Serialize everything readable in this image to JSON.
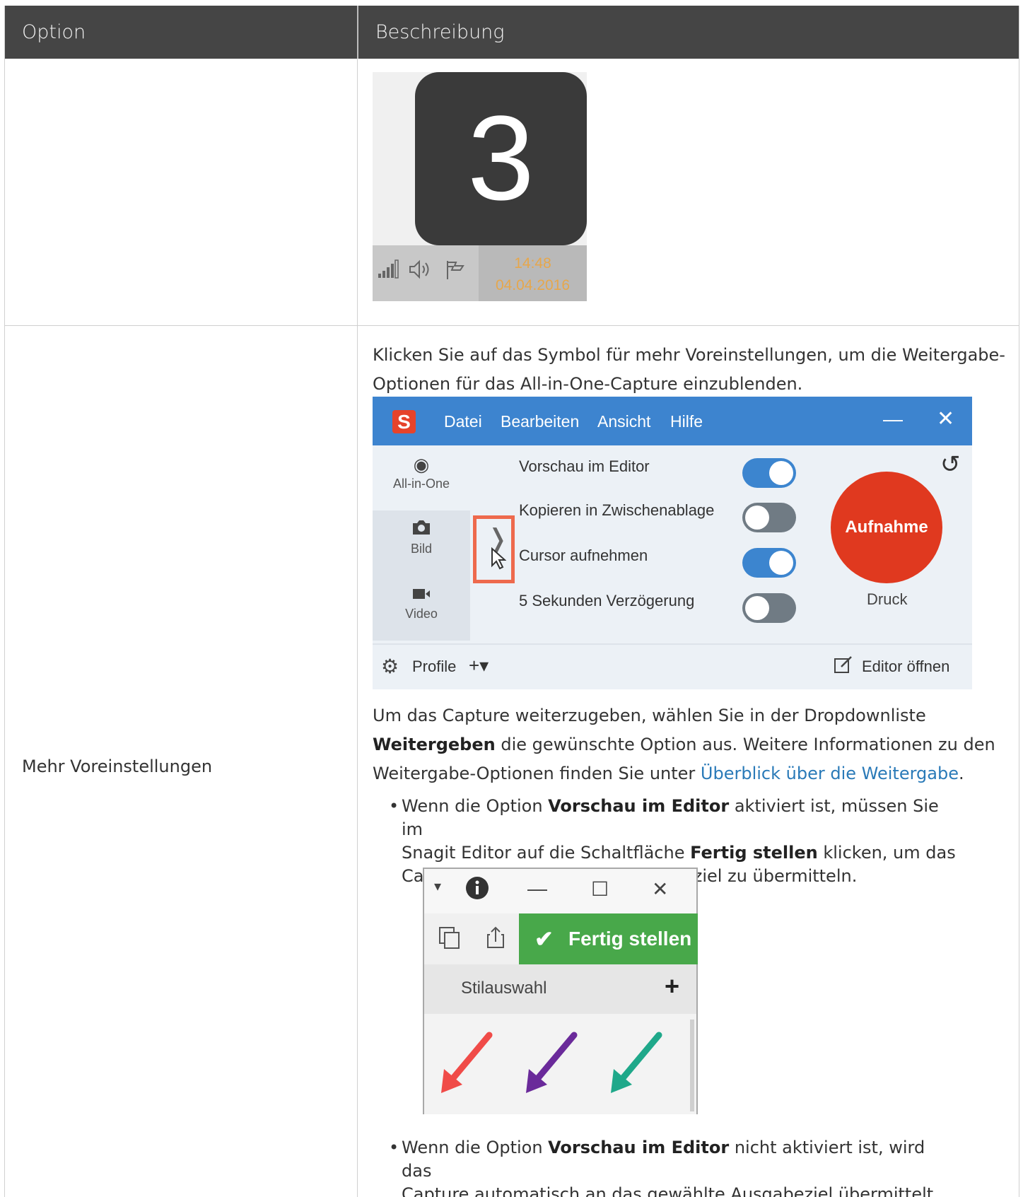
{
  "table": {
    "header": {
      "option": "Option",
      "description": "Beschreibung"
    },
    "row2_option": "Mehr Voreinstellungen"
  },
  "countdown": {
    "number": "3",
    "time": "14:48",
    "date": "04.04.2016"
  },
  "intro_text": {
    "line1": "Klicken Sie auf das Symbol für mehr Voreinstellungen, um die Weitergabe-",
    "line2": "Optionen für das All-in-One-Capture einzublenden."
  },
  "capture_window": {
    "logo": "S",
    "menu": [
      "Datei",
      "Bearbeiten",
      "Ansicht",
      "Hilfe"
    ],
    "modes": [
      "All-in-One",
      "Bild",
      "Video"
    ],
    "options": [
      {
        "label": "Vorschau im Editor",
        "on": true
      },
      {
        "label": "Kopieren in Zwischenablage",
        "on": false
      },
      {
        "label": "Cursor aufnehmen",
        "on": true
      },
      {
        "label": "5 Sekunden Verzögerung",
        "on": false
      }
    ],
    "capture_button": "Aufnahme",
    "hotkey": "Druck",
    "profiles": "Profile",
    "open_editor": "Editor öffnen"
  },
  "share_text": {
    "line1": "Um das Capture weiterzugeben, wählen Sie in der Dropdownliste",
    "line2_bold": "Weitergeben",
    "line2_rest": " die gewünschte Option aus. Weitere Informationen zu den",
    "line3_pre": "Weitergabe-Optionen finden Sie unter ",
    "line3_link": "Überblick über die Weitergabe",
    "line3_post": "."
  },
  "bullet1": {
    "a": "Wenn die Option ",
    "b": "Vorschau im Editor",
    "c": " aktiviert ist, müssen Sie im",
    "d": "Snagit Editor auf die Schaltfläche ",
    "e": "Fertig stellen",
    "f": " klicken, um das",
    "g": "Capture an das gewählte Ausgabeziel zu übermitteln."
  },
  "editor": {
    "done_button": "Fertig stellen",
    "style_label": "Stilauswahl",
    "arrow_colors": [
      "#f04b48",
      "#6a2a9a",
      "#1fa88a"
    ]
  },
  "bullet2": {
    "a": "Wenn die Option ",
    "b": "Vorschau im Editor",
    "c": " nicht aktiviert ist, wird das",
    "d": "Capture automatisch an das gewählte Ausgabeziel übermittelt."
  }
}
